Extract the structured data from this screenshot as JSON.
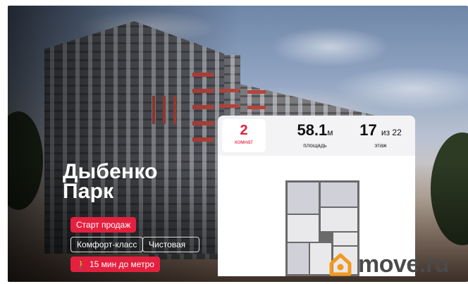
{
  "listing": {
    "title_line1": "Дыбенко",
    "title_line2": "Парк",
    "sale_badge": "Старт продаж",
    "class_badge": "Комфорт-класс",
    "finish_badge": "Чистовая",
    "metro_badge": "15 мин до метро",
    "metro_icon": "walking-person-icon"
  },
  "stats": {
    "rooms_value": "2",
    "rooms_label": "комнат",
    "area_value": "58.1",
    "area_unit": "м",
    "area_label": "площадь",
    "floor_value": "17",
    "floor_of": "из 22",
    "floor_label": "этаж"
  },
  "watermark": {
    "text": "move.ru",
    "icon": "house-logo-icon",
    "accent_color": "#f39a1f"
  },
  "colors": {
    "brand_red": "#e4203f"
  }
}
